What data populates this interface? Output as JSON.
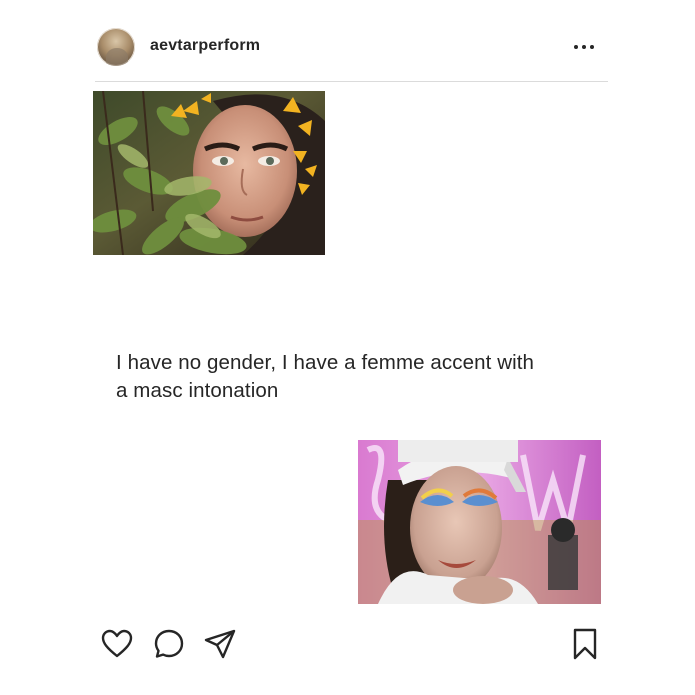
{
  "post": {
    "username": "aevtarperform",
    "caption_lines": [
      "I have no gender, I have a femme accent with",
      "a masc intonation"
    ]
  },
  "icons": {
    "more": "more-horizontal-icon",
    "like": "heart-icon",
    "comment": "comment-bubble-icon",
    "share": "paper-plane-icon",
    "save": "bookmark-icon"
  },
  "colors": {
    "text": "#262626",
    "divider": "#dbdbdb",
    "background": "#ffffff"
  }
}
